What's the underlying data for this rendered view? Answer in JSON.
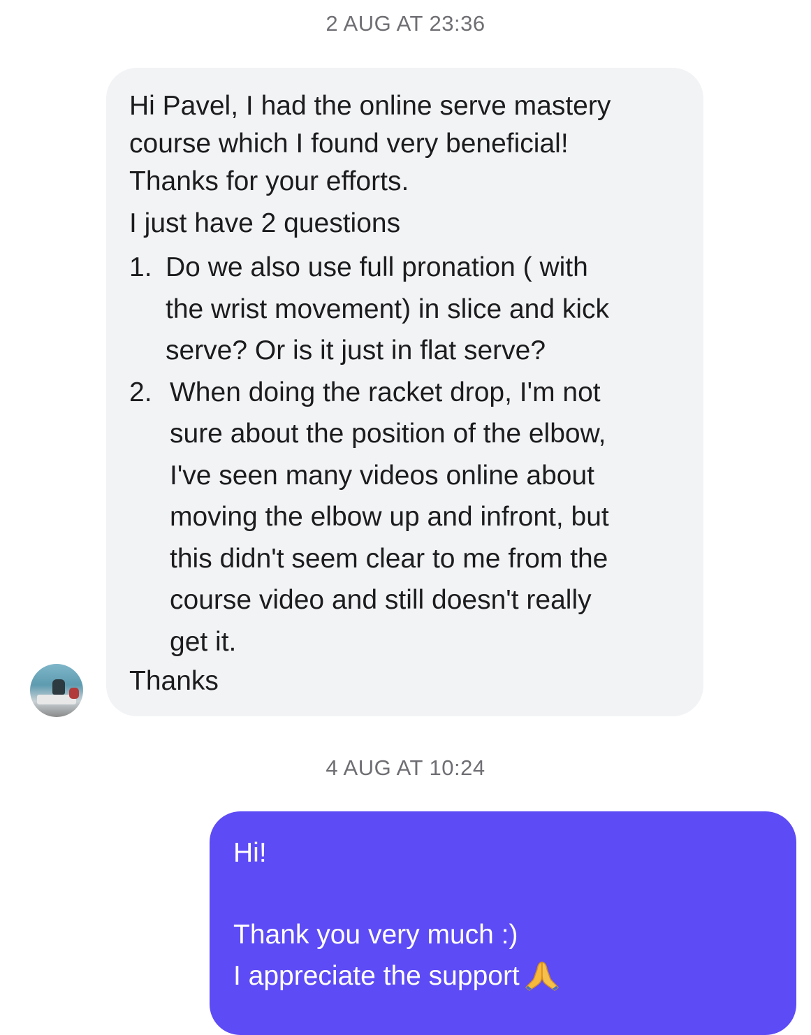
{
  "conversation": {
    "timestamp_1": "2 AUG AT 23:36",
    "incoming_message": {
      "line_1": "Hi Pavel, I had the online serve mastery",
      "line_2": "course which I found very beneficial!",
      "line_3": "Thanks for your efforts.",
      "line_4": "I just have 2 questions",
      "items": [
        {
          "number": "1.",
          "text": "Do we also use full pronation ( with\nthe wrist movement) in slice and kick\nserve? Or is it just in flat serve?"
        },
        {
          "number": "2.",
          "text": "When doing the racket drop, I'm not\nsure about the position of the elbow,\nI've seen many videos online about\nmoving the elbow up and infront, but\nthis didn't seem clear to me from the\ncourse video and still doesn't really\nget it."
        }
      ],
      "closing": "Thanks"
    },
    "avatar_icon": "user-avatar-photo",
    "timestamp_2": "4 AUG AT 10:24",
    "outgoing_message": {
      "line_1": "Hi!",
      "line_2": "Thank you very much :)",
      "line_3": "I appreciate the support",
      "emoji": "folded-hands-icon"
    },
    "colors": {
      "incoming_bubble": "#f2f3f5",
      "outgoing_bubble": "#5d4bf6",
      "timestamp_text": "#6e6e73"
    }
  }
}
